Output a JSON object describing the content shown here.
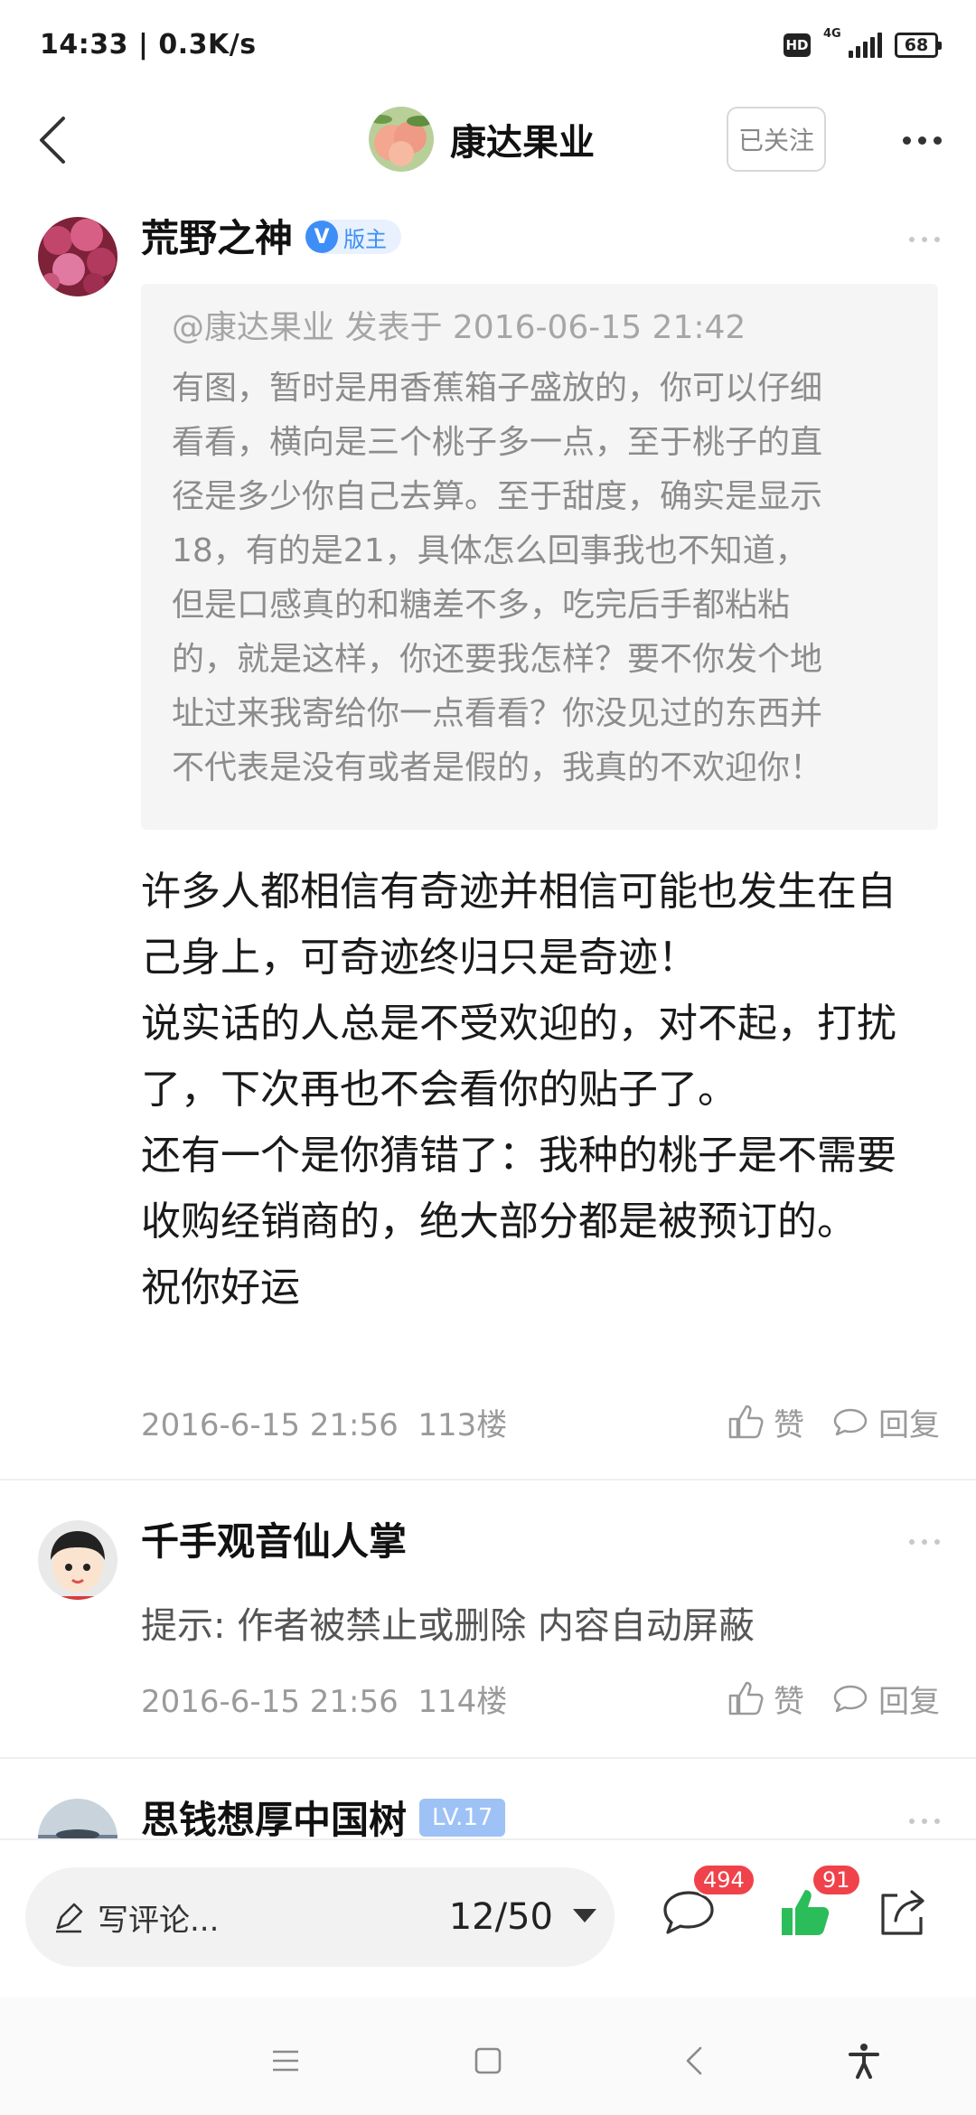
{
  "status_bar": {
    "time": "14:33 | 0.3K/s",
    "hd": "HD",
    "network": "4G",
    "battery": "68"
  },
  "header": {
    "title": "康达果业",
    "follow_label": "已关注"
  },
  "posts": [
    {
      "username": "荒野之神",
      "verified": "V",
      "role": "版主",
      "quote_meta": "@康达果业 发表于 2016-06-15 21:42",
      "quote_lines": [
        "有图，暂时是用香蕉箱子盛放的，你可以仔细",
        "看看，横向是三个桃子多一点，至于桃子的直",
        "径是多少你自己去算。至于甜度，确实是显示",
        "18，有的是21，具体怎么回事我也不知道，",
        "但是口感真的和糖差不多，吃完后手都粘粘",
        "的，就是这样，你还要我怎样？要不你发个地",
        "址过来我寄给你一点看看？你没见过的东西并",
        "不代表是没有或者是假的，我真的不欢迎你！"
      ],
      "content_lines": [
        "许多人都相信有奇迹并相信可能也发生在自",
        "己身上，可奇迹终归只是奇迹！",
        "说实话的人总是不受欢迎的，对不起，打扰",
        "了，下次再也不会看你的贴子了。",
        "还有一个是你猜错了：我种的桃子是不需要",
        "收购经销商的，绝大部分都是被预订的。",
        "祝你好运"
      ],
      "time": "2016-6-15 21:56",
      "floor": "113楼",
      "like_label": "赞",
      "reply_label": "回复"
    },
    {
      "username": "千手观音仙人掌",
      "content": "提示: 作者被禁止或删除 内容自动屏蔽",
      "time": "2016-6-15 21:56",
      "floor": "114楼",
      "like_label": "赞",
      "reply_label": "回复"
    },
    {
      "username": "思钱想厚中国树",
      "level": "LV.17"
    }
  ],
  "bottom_bar": {
    "comment_placeholder": "写评论...",
    "page": "12/50",
    "comment_count": "494",
    "like_count": "91"
  },
  "colors": {
    "accent": "#3e8ef7",
    "like_green": "#2bbd5a",
    "badge_red": "#f0424a"
  },
  "icons": [
    "back-arrow-icon",
    "more-icon",
    "pencil-icon",
    "comment-icon",
    "thumbs-up-icon",
    "share-icon",
    "menu-icon",
    "home-icon",
    "nav-back-icon",
    "accessibility-icon"
  ]
}
